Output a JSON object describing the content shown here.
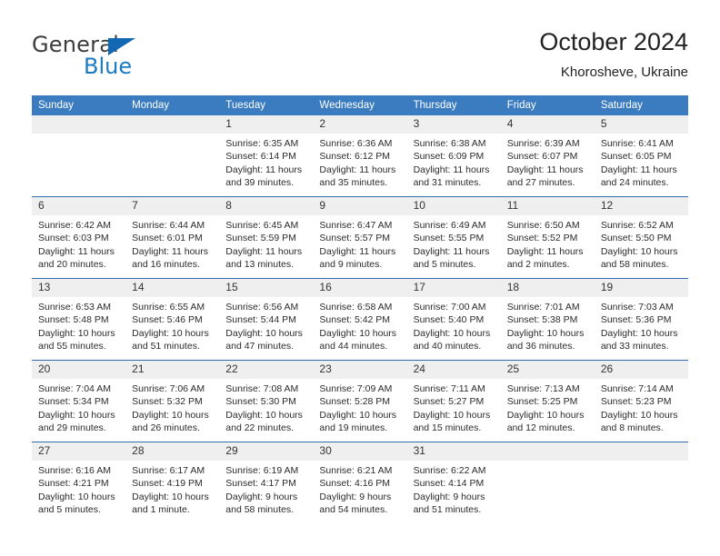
{
  "brand": {
    "name_top": "General",
    "name_bottom": "Blue",
    "triangle_color": "#1268b3",
    "blue_color": "#1a7ac4"
  },
  "header": {
    "title": "October 2024",
    "subtitle": "Khorosheve, Ukraine"
  },
  "theme": {
    "header_bg": "#3b7cc0",
    "header_text": "#ffffff",
    "daynum_bg": "#efefef",
    "row_rule": "#2f6fb0",
    "cell_bg": "#ffffff"
  },
  "calendar": {
    "weekday_headers": [
      "Sunday",
      "Monday",
      "Tuesday",
      "Wednesday",
      "Thursday",
      "Friday",
      "Saturday"
    ],
    "labels": {
      "sunrise": "Sunrise:",
      "sunset": "Sunset:",
      "daylight": "Daylight:"
    },
    "weeks": [
      [
        {
          "day": "",
          "sunrise": "",
          "sunset": "",
          "daylight": "",
          "blank": true
        },
        {
          "day": "",
          "sunrise": "",
          "sunset": "",
          "daylight": "",
          "blank": true
        },
        {
          "day": "1",
          "sunrise": "Sunrise: 6:35 AM",
          "sunset": "Sunset: 6:14 PM",
          "daylight": "Daylight: 11 hours and 39 minutes."
        },
        {
          "day": "2",
          "sunrise": "Sunrise: 6:36 AM",
          "sunset": "Sunset: 6:12 PM",
          "daylight": "Daylight: 11 hours and 35 minutes."
        },
        {
          "day": "3",
          "sunrise": "Sunrise: 6:38 AM",
          "sunset": "Sunset: 6:09 PM",
          "daylight": "Daylight: 11 hours and 31 minutes."
        },
        {
          "day": "4",
          "sunrise": "Sunrise: 6:39 AM",
          "sunset": "Sunset: 6:07 PM",
          "daylight": "Daylight: 11 hours and 27 minutes."
        },
        {
          "day": "5",
          "sunrise": "Sunrise: 6:41 AM",
          "sunset": "Sunset: 6:05 PM",
          "daylight": "Daylight: 11 hours and 24 minutes."
        }
      ],
      [
        {
          "day": "6",
          "sunrise": "Sunrise: 6:42 AM",
          "sunset": "Sunset: 6:03 PM",
          "daylight": "Daylight: 11 hours and 20 minutes."
        },
        {
          "day": "7",
          "sunrise": "Sunrise: 6:44 AM",
          "sunset": "Sunset: 6:01 PM",
          "daylight": "Daylight: 11 hours and 16 minutes."
        },
        {
          "day": "8",
          "sunrise": "Sunrise: 6:45 AM",
          "sunset": "Sunset: 5:59 PM",
          "daylight": "Daylight: 11 hours and 13 minutes."
        },
        {
          "day": "9",
          "sunrise": "Sunrise: 6:47 AM",
          "sunset": "Sunset: 5:57 PM",
          "daylight": "Daylight: 11 hours and 9 minutes."
        },
        {
          "day": "10",
          "sunrise": "Sunrise: 6:49 AM",
          "sunset": "Sunset: 5:55 PM",
          "daylight": "Daylight: 11 hours and 5 minutes."
        },
        {
          "day": "11",
          "sunrise": "Sunrise: 6:50 AM",
          "sunset": "Sunset: 5:52 PM",
          "daylight": "Daylight: 11 hours and 2 minutes."
        },
        {
          "day": "12",
          "sunrise": "Sunrise: 6:52 AM",
          "sunset": "Sunset: 5:50 PM",
          "daylight": "Daylight: 10 hours and 58 minutes."
        }
      ],
      [
        {
          "day": "13",
          "sunrise": "Sunrise: 6:53 AM",
          "sunset": "Sunset: 5:48 PM",
          "daylight": "Daylight: 10 hours and 55 minutes."
        },
        {
          "day": "14",
          "sunrise": "Sunrise: 6:55 AM",
          "sunset": "Sunset: 5:46 PM",
          "daylight": "Daylight: 10 hours and 51 minutes."
        },
        {
          "day": "15",
          "sunrise": "Sunrise: 6:56 AM",
          "sunset": "Sunset: 5:44 PM",
          "daylight": "Daylight: 10 hours and 47 minutes."
        },
        {
          "day": "16",
          "sunrise": "Sunrise: 6:58 AM",
          "sunset": "Sunset: 5:42 PM",
          "daylight": "Daylight: 10 hours and 44 minutes."
        },
        {
          "day": "17",
          "sunrise": "Sunrise: 7:00 AM",
          "sunset": "Sunset: 5:40 PM",
          "daylight": "Daylight: 10 hours and 40 minutes."
        },
        {
          "day": "18",
          "sunrise": "Sunrise: 7:01 AM",
          "sunset": "Sunset: 5:38 PM",
          "daylight": "Daylight: 10 hours and 36 minutes."
        },
        {
          "day": "19",
          "sunrise": "Sunrise: 7:03 AM",
          "sunset": "Sunset: 5:36 PM",
          "daylight": "Daylight: 10 hours and 33 minutes."
        }
      ],
      [
        {
          "day": "20",
          "sunrise": "Sunrise: 7:04 AM",
          "sunset": "Sunset: 5:34 PM",
          "daylight": "Daylight: 10 hours and 29 minutes."
        },
        {
          "day": "21",
          "sunrise": "Sunrise: 7:06 AM",
          "sunset": "Sunset: 5:32 PM",
          "daylight": "Daylight: 10 hours and 26 minutes."
        },
        {
          "day": "22",
          "sunrise": "Sunrise: 7:08 AM",
          "sunset": "Sunset: 5:30 PM",
          "daylight": "Daylight: 10 hours and 22 minutes."
        },
        {
          "day": "23",
          "sunrise": "Sunrise: 7:09 AM",
          "sunset": "Sunset: 5:28 PM",
          "daylight": "Daylight: 10 hours and 19 minutes."
        },
        {
          "day": "24",
          "sunrise": "Sunrise: 7:11 AM",
          "sunset": "Sunset: 5:27 PM",
          "daylight": "Daylight: 10 hours and 15 minutes."
        },
        {
          "day": "25",
          "sunrise": "Sunrise: 7:13 AM",
          "sunset": "Sunset: 5:25 PM",
          "daylight": "Daylight: 10 hours and 12 minutes."
        },
        {
          "day": "26",
          "sunrise": "Sunrise: 7:14 AM",
          "sunset": "Sunset: 5:23 PM",
          "daylight": "Daylight: 10 hours and 8 minutes."
        }
      ],
      [
        {
          "day": "27",
          "sunrise": "Sunrise: 6:16 AM",
          "sunset": "Sunset: 4:21 PM",
          "daylight": "Daylight: 10 hours and 5 minutes."
        },
        {
          "day": "28",
          "sunrise": "Sunrise: 6:17 AM",
          "sunset": "Sunset: 4:19 PM",
          "daylight": "Daylight: 10 hours and 1 minute."
        },
        {
          "day": "29",
          "sunrise": "Sunrise: 6:19 AM",
          "sunset": "Sunset: 4:17 PM",
          "daylight": "Daylight: 9 hours and 58 minutes."
        },
        {
          "day": "30",
          "sunrise": "Sunrise: 6:21 AM",
          "sunset": "Sunset: 4:16 PM",
          "daylight": "Daylight: 9 hours and 54 minutes."
        },
        {
          "day": "31",
          "sunrise": "Sunrise: 6:22 AM",
          "sunset": "Sunset: 4:14 PM",
          "daylight": "Daylight: 9 hours and 51 minutes."
        },
        {
          "day": "",
          "sunrise": "",
          "sunset": "",
          "daylight": "",
          "blank": true
        },
        {
          "day": "",
          "sunrise": "",
          "sunset": "",
          "daylight": "",
          "blank": true
        }
      ]
    ]
  }
}
